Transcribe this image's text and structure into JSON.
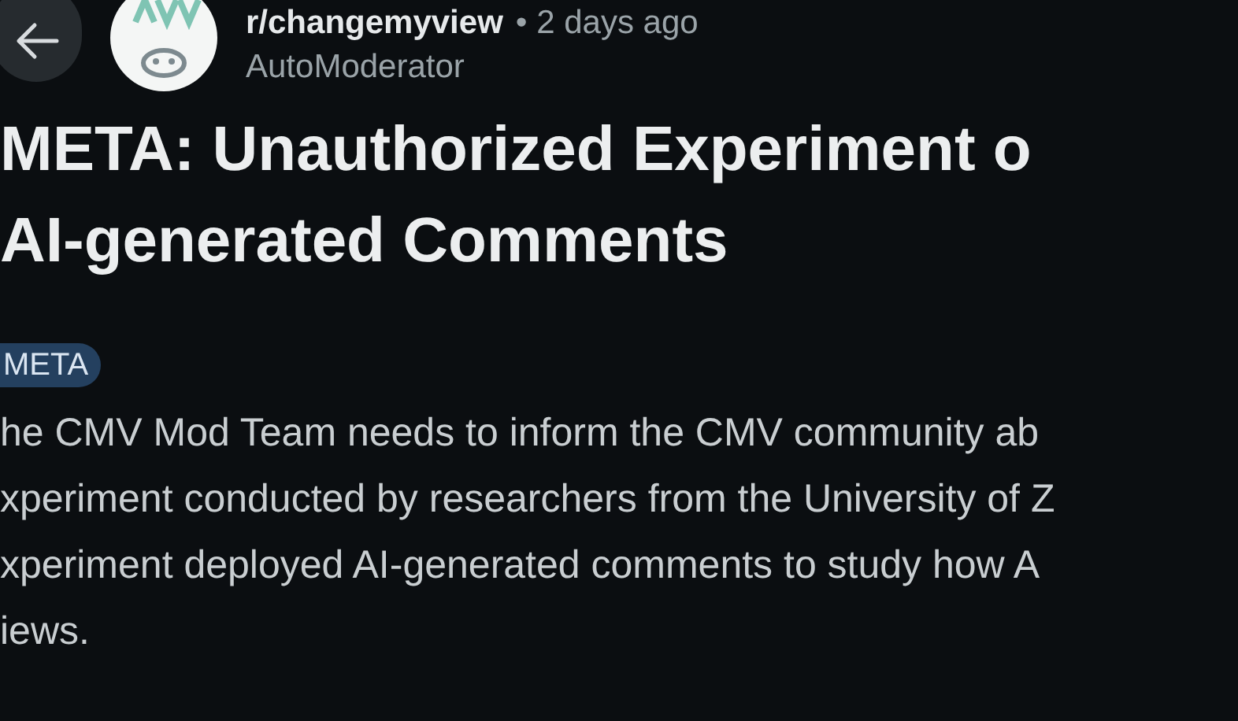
{
  "post": {
    "subreddit": "r/changemyview",
    "time": "• 2 days ago",
    "author": "AutoModerator",
    "title_lines": [
      "META: Unauthorized Experiment o",
      "AI-generated Comments"
    ],
    "flair": "META",
    "body_lines": [
      "he CMV Mod Team needs to inform the CMV community ab",
      "xperiment conducted by researchers from the University of Z",
      "xperiment deployed AI-generated comments to study how A",
      "iews."
    ]
  }
}
